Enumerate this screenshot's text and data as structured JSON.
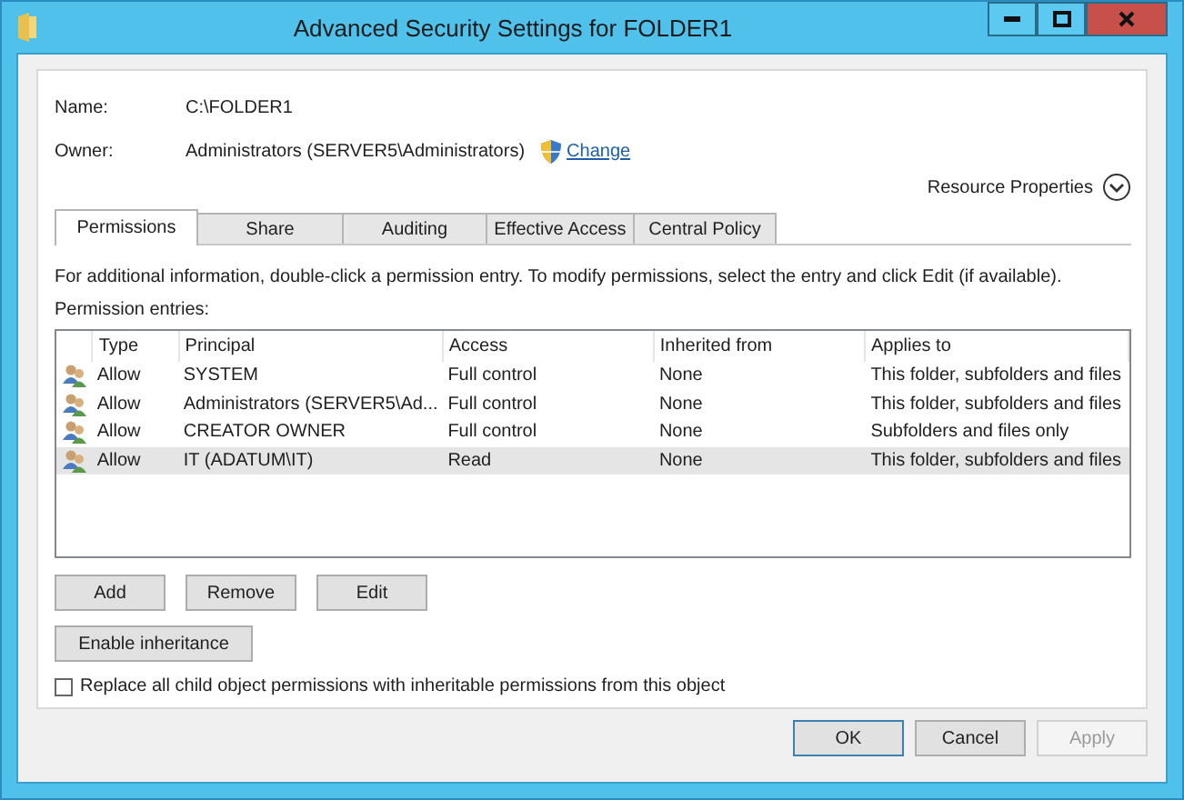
{
  "window": {
    "title": "Advanced Security Settings for FOLDER1"
  },
  "name": {
    "label": "Name:",
    "value": "C:\\FOLDER1"
  },
  "owner": {
    "label": "Owner:",
    "value": "Administrators (SERVER5\\Administrators)",
    "link": "Change"
  },
  "resource_properties": {
    "label": "Resource Properties",
    "expanded": false
  },
  "tabs": [
    {
      "label": "Permissions",
      "selected": true
    },
    {
      "label": "Share",
      "selected": false
    },
    {
      "label": "Auditing",
      "selected": false
    },
    {
      "label": "Effective Access",
      "selected": false
    },
    {
      "label": "Central Policy",
      "selected": false
    }
  ],
  "info": "For additional information, double-click a permission entry. To modify permissions, select the entry and click Edit (if available).",
  "entries_label": "Permission entries:",
  "table": {
    "columns": [
      "Type",
      "Principal",
      "Access",
      "Inherited from",
      "Applies to"
    ],
    "rows": [
      {
        "cells": [
          "Allow",
          "SYSTEM",
          "Full control",
          "None",
          "This folder, subfolders and files"
        ],
        "selected": false
      },
      {
        "cells": [
          "Allow",
          "Administrators (SERVER5\\Ad...",
          "Full control",
          "None",
          "This folder, subfolders and files"
        ],
        "selected": false
      },
      {
        "cells": [
          "Allow",
          "CREATOR OWNER",
          "Full control",
          "None",
          "Subfolders and files only"
        ],
        "selected": false
      },
      {
        "cells": [
          "Allow",
          "IT (ADATUM\\IT)",
          "Read",
          "None",
          "This folder, subfolders and files"
        ],
        "selected": true
      }
    ]
  },
  "entry_buttons": [
    {
      "label": "Add"
    },
    {
      "label": "Remove"
    },
    {
      "label": "Edit"
    }
  ],
  "inheritance_button": {
    "label": "Enable inheritance"
  },
  "replace_checkbox": {
    "label": "Replace all child object permissions with inheritable permissions from this object",
    "checked": false
  },
  "dialog_buttons": [
    {
      "label": "OK",
      "disabled": false,
      "default": true
    },
    {
      "label": "Cancel",
      "disabled": false,
      "default": false
    },
    {
      "label": "Apply",
      "disabled": true,
      "default": false
    }
  ]
}
